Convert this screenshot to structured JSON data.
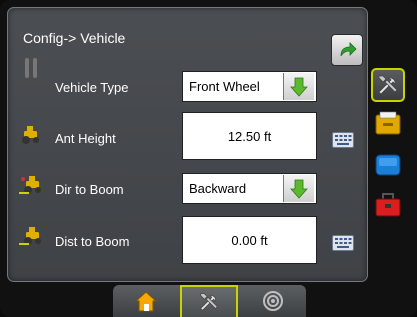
{
  "title": "Config-> Vehicle",
  "rows": [
    {
      "label": "Vehicle Type",
      "icon": "vehicle-type-icon",
      "value": "Front Wheel",
      "control": "dropdown"
    },
    {
      "label": "Ant Height",
      "icon": "antenna-height-icon",
      "value": "12.50 ft",
      "control": "numeric"
    },
    {
      "label": "Dir to Boom",
      "icon": "boom-direction-icon",
      "value": "Backward",
      "control": "dropdown"
    },
    {
      "label": "Dist to Boom",
      "icon": "boom-distance-icon",
      "value": "0.00 ft",
      "control": "numeric"
    }
  ],
  "side_tabs": [
    {
      "icon": "tools-icon",
      "active": true
    },
    {
      "icon": "folder-icon",
      "active": false
    },
    {
      "icon": "screen-icon",
      "active": false
    },
    {
      "icon": "toolbox-icon",
      "active": false
    }
  ],
  "bottom_tabs": [
    {
      "icon": "home-icon",
      "active": false
    },
    {
      "icon": "tools-icon",
      "active": true
    },
    {
      "icon": "gps-target-icon",
      "active": false
    }
  ],
  "colors": {
    "accent_green": "#5cb82e",
    "active_border": "#c8d400",
    "panel": "#45484c"
  }
}
